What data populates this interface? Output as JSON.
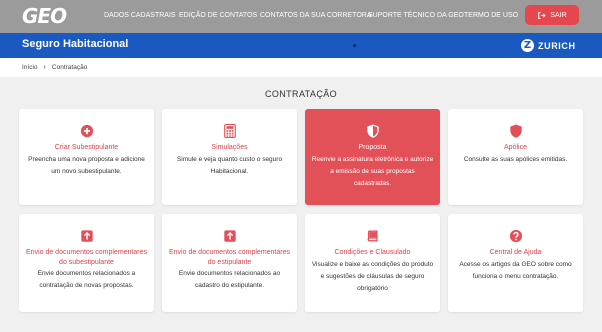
{
  "brand": {
    "logo_text": "GEO"
  },
  "nav": [
    {
      "label": "DADOS CADASTRAIS"
    },
    {
      "label": "EDIÇÃO DE CONTATOS"
    },
    {
      "label": "CONTATOS DA SUA CORRETORA"
    },
    {
      "label": "SUPORTE TÉCNICO DA GEO"
    },
    {
      "label": "TERMO DE USO"
    }
  ],
  "exit_button": {
    "label": "SAIR",
    "icon": "sign-out-icon"
  },
  "product_bar": {
    "title": "Seguro Habitacional",
    "insurer": "ZURICH",
    "insurer_mark": "Z"
  },
  "breadcrumb": {
    "home": "Início",
    "separator": "›",
    "current": "Contratação"
  },
  "section": {
    "title": "CONTRATAÇÃO"
  },
  "colors": {
    "accent": "#e25158",
    "topbar": "#9b9b9b",
    "brand_blue": "#1a59c0"
  },
  "cards": [
    {
      "title": "Criar Subestipulante",
      "desc": "Preencha uma nova proposta e adicione um novo subestipulante.",
      "icon": "plus-circle-icon",
      "active": false
    },
    {
      "title": "Simulações",
      "desc": "Simule e veja quanto custo o seguro Habitacional.",
      "icon": "calculator-icon",
      "active": false
    },
    {
      "title": "Proposta",
      "desc": "Reenvie a assinatura eletrônica e autorize a emissão de suas propostas cadastradas.",
      "icon": "shield-icon",
      "active": true
    },
    {
      "title": "Apólice",
      "desc": "Consulte as suas apólices emitidas.",
      "icon": "shield-icon",
      "active": false
    },
    {
      "title": "Envio de documentos complementares do subestipulante",
      "desc": "Envie documentos relacionados a contratação de novas propostas.",
      "icon": "upload-icon",
      "active": false
    },
    {
      "title": "Envio de documentos complementares do estipulante",
      "desc": "Envie documentos relacionados ao cadastro do estipulante.",
      "icon": "upload-icon",
      "active": false
    },
    {
      "title": "Condições e Clausulado",
      "desc": "Visualize e baixe as condições do produto e sugestões de cláusulas de seguro obrigatório",
      "icon": "book-icon",
      "active": false
    },
    {
      "title": "Central de Ajuda",
      "desc": "Acesse os artigos da GEO sobre como funciona o menu contratação.",
      "icon": "question-circle-icon",
      "active": false
    }
  ]
}
